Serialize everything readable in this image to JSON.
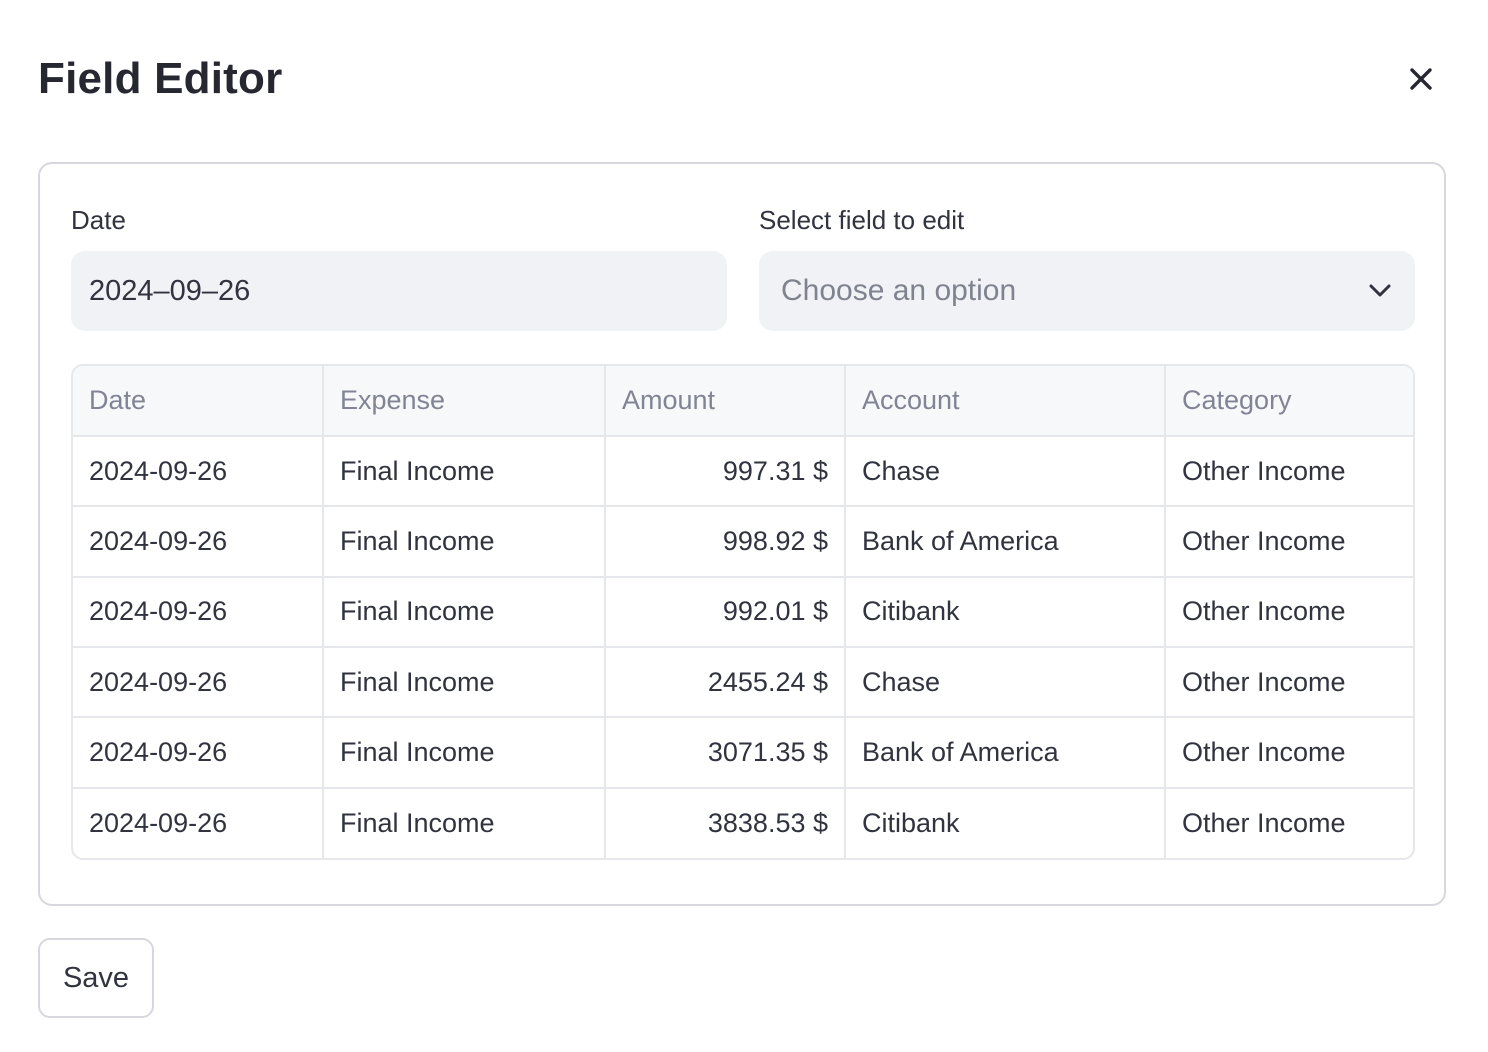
{
  "dialog": {
    "title": "Field Editor",
    "close_icon": "close-icon"
  },
  "form": {
    "date_label": "Date",
    "date_value": "2024–09–26",
    "select_label": "Select field to edit",
    "select_placeholder": "Choose an option",
    "select_icon": "chevron-down-icon"
  },
  "table": {
    "headers": [
      "Date",
      "Expense",
      "Amount",
      "Account",
      "Category"
    ],
    "rows": [
      [
        "2024-09-26",
        "Final Income",
        "997.31 $",
        "Chase",
        "Other Income"
      ],
      [
        "2024-09-26",
        "Final Income",
        "998.92 $",
        "Bank of America",
        "Other Income"
      ],
      [
        "2024-09-26",
        "Final Income",
        "992.01 $",
        "Citibank",
        "Other Income"
      ],
      [
        "2024-09-26",
        "Final Income",
        "2455.24 $",
        "Chase",
        "Other Income"
      ],
      [
        "2024-09-26",
        "Final Income",
        "3071.35 $",
        "Bank of America",
        "Other Income"
      ],
      [
        "2024-09-26",
        "Final Income",
        "3838.53 $",
        "Citibank",
        "Other Income"
      ]
    ]
  },
  "actions": {
    "save_label": "Save"
  },
  "colors": {
    "input_background": "#f0f2f6",
    "border": "#d6d8de",
    "header_text": "#808495",
    "body_text": "#31333f"
  }
}
